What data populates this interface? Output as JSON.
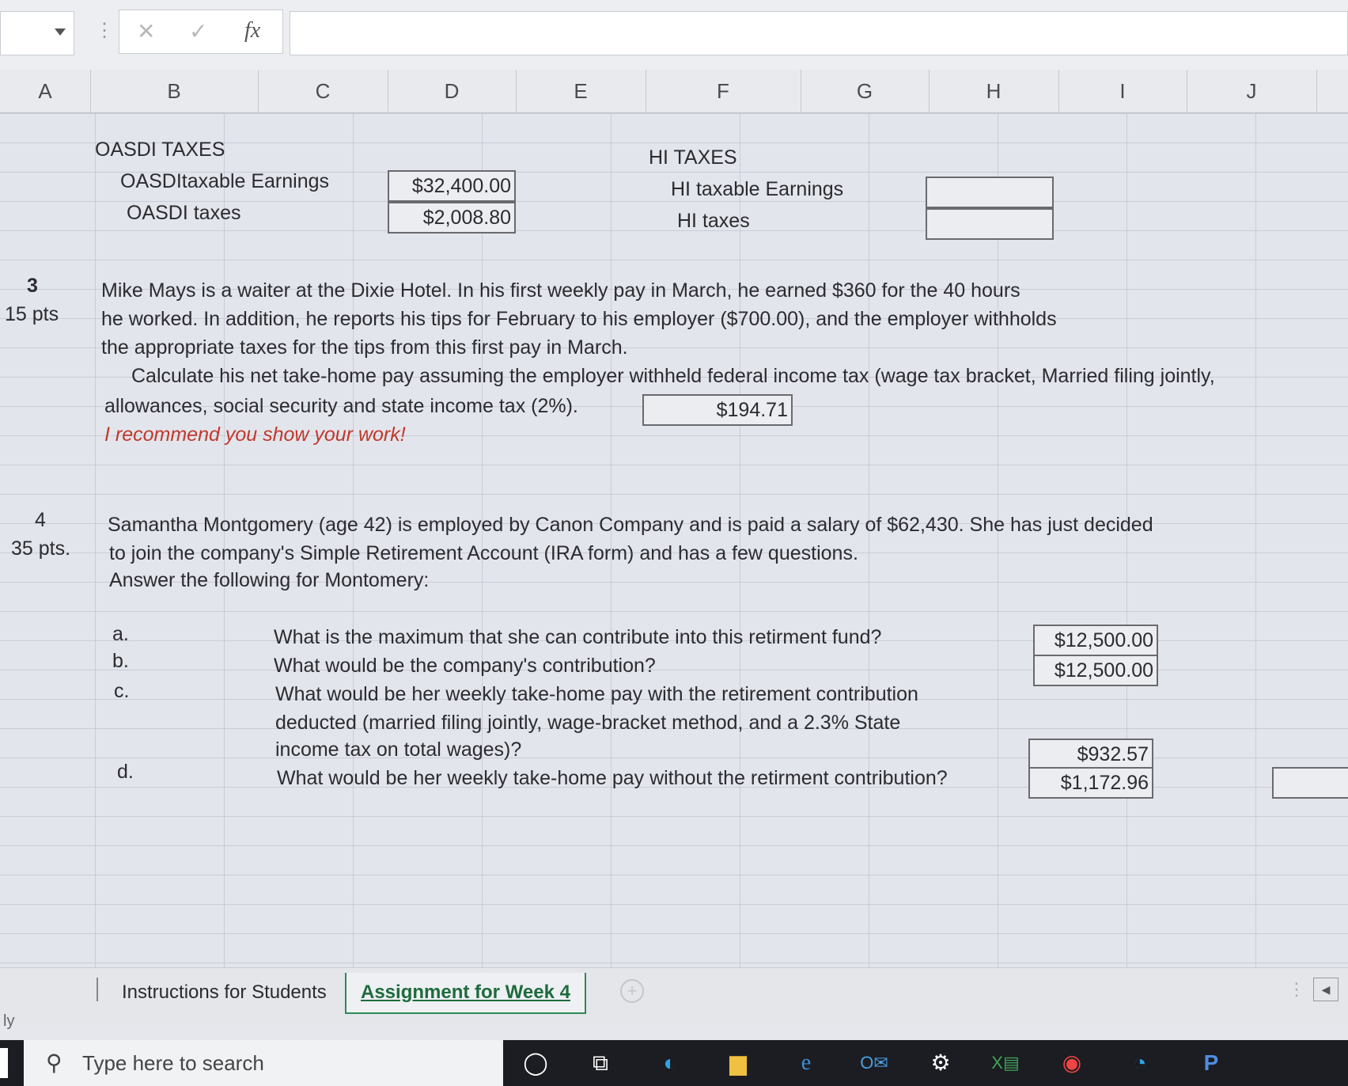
{
  "formula_bar": {
    "cancel_icon": "close-icon",
    "confirm_icon": "check-icon",
    "fx_label": "fx",
    "formula_value": ""
  },
  "columns": [
    "A",
    "B",
    "C",
    "D",
    "E",
    "F",
    "G",
    "H",
    "I",
    "J"
  ],
  "oasdi": {
    "header": "OASDI TAXES",
    "earnings_label": "OASDItaxable Earnings",
    "earnings_value": "$32,400.00",
    "taxes_label": "OASDI taxes",
    "taxes_value": "$2,008.80"
  },
  "hi": {
    "header": "HI TAXES",
    "earnings_label": "HI taxable Earnings",
    "earnings_value": "",
    "taxes_label": "HI taxes",
    "taxes_value": ""
  },
  "q3": {
    "number": "3",
    "points": "15 pts",
    "line1": "Mike Mays is a waiter at the Dixie Hotel. In his first weekly pay in March, he earned $360 for the 40 hours",
    "line2": "he worked.  In addition, he reports his tips for February to his employer ($700.00), and the employer withholds",
    "line3": "the appropriate taxes for the tips from this first pay in March.",
    "line4": "Calculate his net take-home pay assuming the employer withheld federal income tax (wage tax bracket, Married filing jointly,",
    "line5": "allowances, social security and state income tax (2%).",
    "answer": "$194.71",
    "note": "I recommend you show your work!"
  },
  "q4": {
    "number": "4",
    "points": "35 pts.",
    "line1": "Samantha Montgomery (age 42) is employed by Canon Company and is paid a salary of $62,430.  She has just decided",
    "line2": "to join the company's Simple Retirement Account (IRA form) and has a few questions.",
    "line3": "Answer the following for Montomery:",
    "a_label": "a.",
    "a_text": "What is the maximum that she can contribute into this retirment fund?",
    "a_answer": "$12,500.00",
    "b_label": "b.",
    "b_text": "What would be the company's contribution?",
    "b_answer": "$12,500.00",
    "c_label": "c.",
    "c_text1": "What would be her weekly take-home pay with the retirement contribution",
    "c_text2": "deducted (married filing jointly, wage-bracket method, and a 2.3% State",
    "c_text3": "income tax on total wages)?",
    "c_answer": "$932.57",
    "d_label": "d.",
    "d_text": "What would be her weekly take-home pay without the retirment contribution?",
    "d_answer": "$1,172.96"
  },
  "sheet_tabs": {
    "tab1": "Instructions for Students",
    "tab2": "Assignment for Week 4",
    "status_left": "ly"
  },
  "taskbar": {
    "search_placeholder": "Type here to search"
  }
}
